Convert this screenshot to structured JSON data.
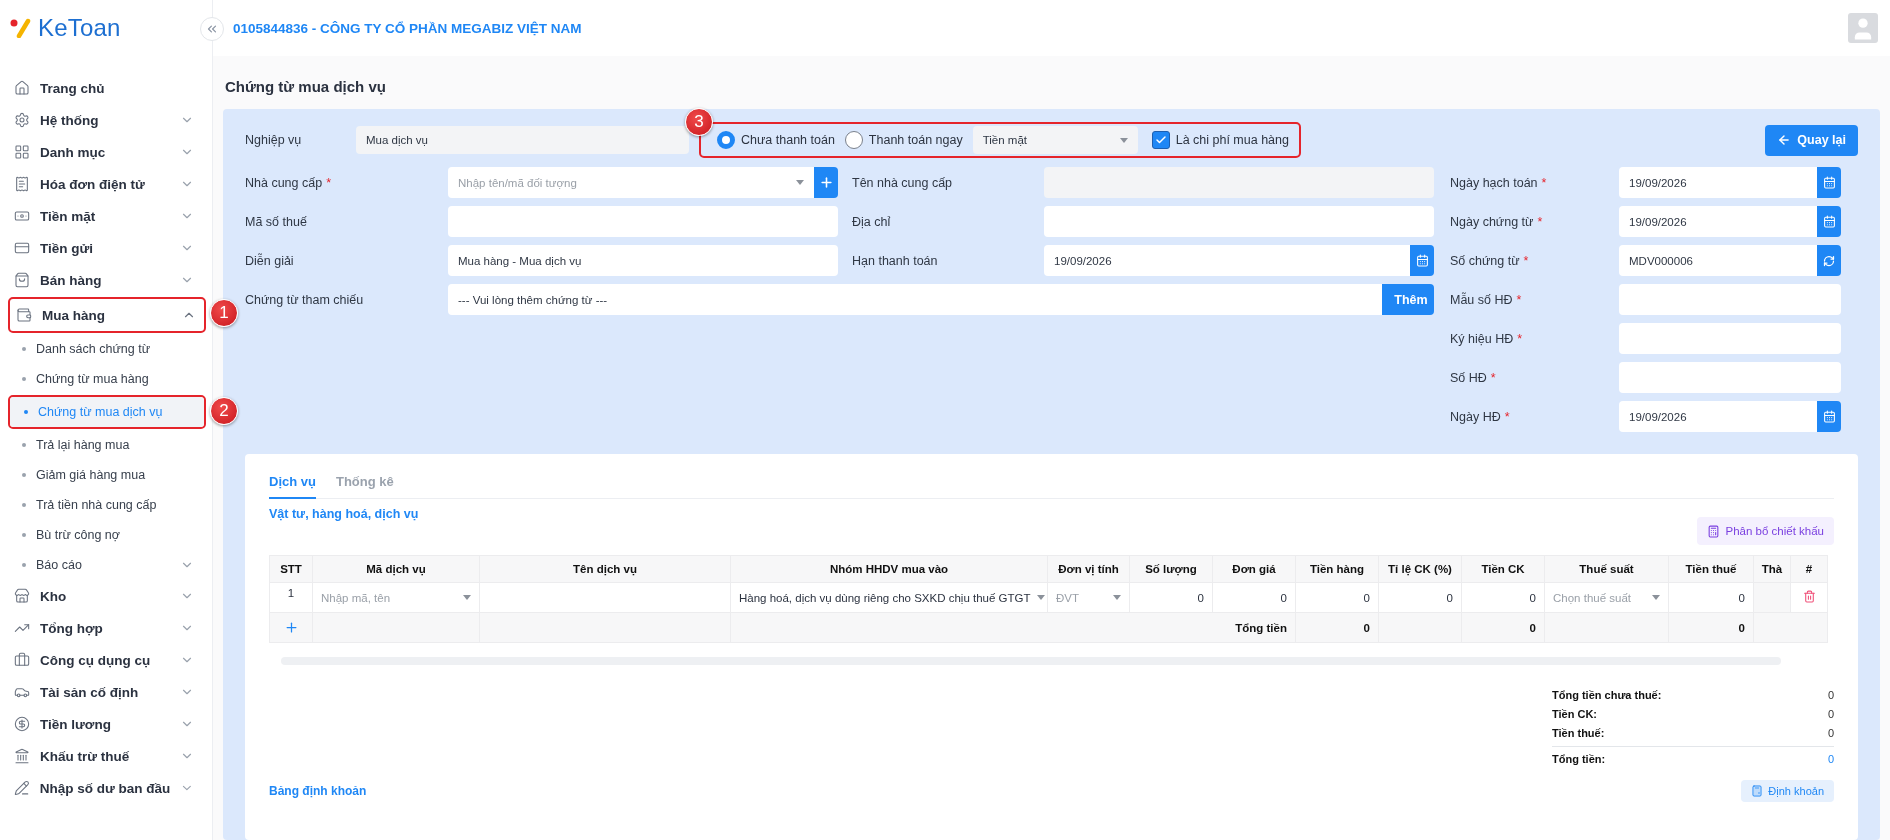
{
  "logo": {
    "text": "KeToan"
  },
  "header": {
    "company": "0105844836 - CÔNG TY CỔ PHẦN MEGABIZ VIỆT NAM"
  },
  "sidebar": {
    "items": [
      {
        "label": "Trang chủ",
        "kind": "link"
      },
      {
        "label": "Hệ thống",
        "kind": "group",
        "expanded": false
      },
      {
        "label": "Danh mục",
        "kind": "group",
        "expanded": false
      },
      {
        "label": "Hóa đơn điện tử",
        "kind": "group",
        "expanded": false
      },
      {
        "label": "Tiền mặt",
        "kind": "group",
        "expanded": false
      },
      {
        "label": "Tiền gửi",
        "kind": "group",
        "expanded": false
      },
      {
        "label": "Bán hàng",
        "kind": "group",
        "expanded": false
      },
      {
        "label": "Mua hàng",
        "kind": "group",
        "expanded": true,
        "callout": "1",
        "children": [
          {
            "label": "Danh sách chứng từ",
            "kind": "link",
            "selected": false
          },
          {
            "label": "Chứng từ mua hàng",
            "kind": "link",
            "selected": false
          },
          {
            "label": "Chứng từ mua dịch vụ",
            "kind": "link",
            "selected": true,
            "callout": "2"
          },
          {
            "label": "Trả lại hàng mua",
            "kind": "link",
            "selected": false
          },
          {
            "label": "Giảm giá hàng mua",
            "kind": "link",
            "selected": false
          },
          {
            "label": "Trả tiền nhà cung cấp",
            "kind": "link",
            "selected": false
          },
          {
            "label": "Bù trừ công nợ",
            "kind": "link",
            "selected": false
          },
          {
            "label": "Báo cáo",
            "kind": "group",
            "selected": false
          }
        ]
      },
      {
        "label": "Kho",
        "kind": "group",
        "expanded": false
      },
      {
        "label": "Tổng hợp",
        "kind": "group",
        "expanded": false
      },
      {
        "label": "Công cụ dụng cụ",
        "kind": "group",
        "expanded": false
      },
      {
        "label": "Tài sản cố định",
        "kind": "group",
        "expanded": false
      },
      {
        "label": "Tiền lương",
        "kind": "group",
        "expanded": false
      },
      {
        "label": "Khấu trừ thuế",
        "kind": "group",
        "expanded": false
      },
      {
        "label": "Nhập số dư ban đầu",
        "kind": "group",
        "expanded": false
      }
    ]
  },
  "page_title": "Chứng từ mua dịch vụ",
  "form": {
    "operation": {
      "label": "Nghiệp vụ",
      "value": "Mua dịch vụ"
    },
    "payment": {
      "callout": "3",
      "options": [
        {
          "label": "Chưa thanh toán",
          "selected": true
        },
        {
          "label": "Thanh toán ngay",
          "selected": false
        }
      ],
      "method": "Tiền mặt",
      "expense": {
        "label": "Là chi phí mua hàng",
        "checked": true
      }
    },
    "back_button": "Quay lại",
    "fields": [
      {
        "label": "Nhà cung cấp",
        "required_mark": "*",
        "kind": "select_add",
        "placeholder": "Nhập tên/mã đối tượng"
      },
      {
        "label": "Tên nhà cung cấp",
        "kind": "readonly"
      },
      {
        "label": "Mã số thuế",
        "kind": "text"
      },
      {
        "label": "Địa chỉ",
        "kind": "text"
      },
      {
        "label": "Diễn giải",
        "kind": "text",
        "value": "Mua hàng - Mua dịch vụ"
      },
      {
        "label": "Hạn thanh toán",
        "kind": "date",
        "value": "19/09/2026"
      },
      {
        "label": "Chứng từ tham chiếu",
        "kind": "ref",
        "value": "--- Vui lòng thêm chứng từ ---",
        "button": "Thêm"
      }
    ],
    "right_fields": [
      {
        "label": "Ngày hạch toán",
        "required_mark": "*",
        "kind": "date",
        "value": "19/09/2026"
      },
      {
        "label": "Ngày chứng từ",
        "required_mark": "*",
        "kind": "date",
        "value": "19/09/2026"
      },
      {
        "label": "Số chứng từ",
        "required_mark": "*",
        "kind": "code",
        "value": "MDV000006"
      },
      {
        "label": "Mẫu số HĐ",
        "required_mark": "*",
        "kind": "text"
      },
      {
        "label": "Ký hiệu HĐ",
        "required_mark": "*",
        "kind": "text"
      },
      {
        "label": "Số HĐ",
        "required_mark": "*",
        "kind": "text"
      },
      {
        "label": "Ngày HĐ",
        "required_mark": "*",
        "kind": "date",
        "value": "19/09/2026"
      }
    ]
  },
  "detail": {
    "tabs": [
      {
        "label": "Dịch vụ",
        "selected": true
      },
      {
        "label": "Thống kê",
        "selected": false
      }
    ],
    "section_title": "Vật tư, hàng hoá, dịch vụ",
    "discount_button": "Phân bổ chiết khấu",
    "table": {
      "columns": [
        "STT",
        "Mã dịch vụ",
        "Tên dịch vụ",
        "Nhóm HHDV mua vào",
        "Đơn vị tính",
        "Số lượng",
        "Đơn giá",
        "Tiền hàng",
        "Tỉ lệ CK (%)",
        "Tiền CK",
        "Thuế suất",
        "Tiền thuế",
        "Thà",
        "#"
      ],
      "rows": [
        {
          "cells": [
            {
              "kind": "index",
              "value": "1"
            },
            {
              "kind": "select",
              "placeholder": "Nhập mã, tên"
            },
            {
              "kind": "empty"
            },
            {
              "kind": "select",
              "value": "Hàng hoá, dịch vụ dùng riêng cho SXKD chịu thuế GTGT"
            },
            {
              "kind": "select",
              "placeholder": "ĐVT"
            },
            {
              "kind": "number",
              "value": "0"
            },
            {
              "kind": "number",
              "value": "0"
            },
            {
              "kind": "number",
              "value": "0"
            },
            {
              "kind": "number",
              "value": "0"
            },
            {
              "kind": "number",
              "value": "0"
            },
            {
              "kind": "select",
              "placeholder": "Chọn thuế suất"
            },
            {
              "kind": "number",
              "value": "0"
            },
            {
              "kind": "blank"
            },
            {
              "kind": "delete"
            }
          ]
        }
      ],
      "totals": {
        "label": "Tổng tiền",
        "amount": "0",
        "discount": "0",
        "tax": "0"
      }
    },
    "summary": [
      {
        "label": "Tổng tiền chưa thuế:",
        "value": "0",
        "kind": "line"
      },
      {
        "label": "Tiền CK:",
        "value": "0",
        "kind": "line"
      },
      {
        "label": "Tiền thuế:",
        "value": "0",
        "kind": "line"
      },
      {
        "label": "Tổng tiền:",
        "value": "0",
        "kind": "total"
      }
    ],
    "ledger_title": "Bảng định khoản",
    "ledger_button": "Định khoản"
  }
}
